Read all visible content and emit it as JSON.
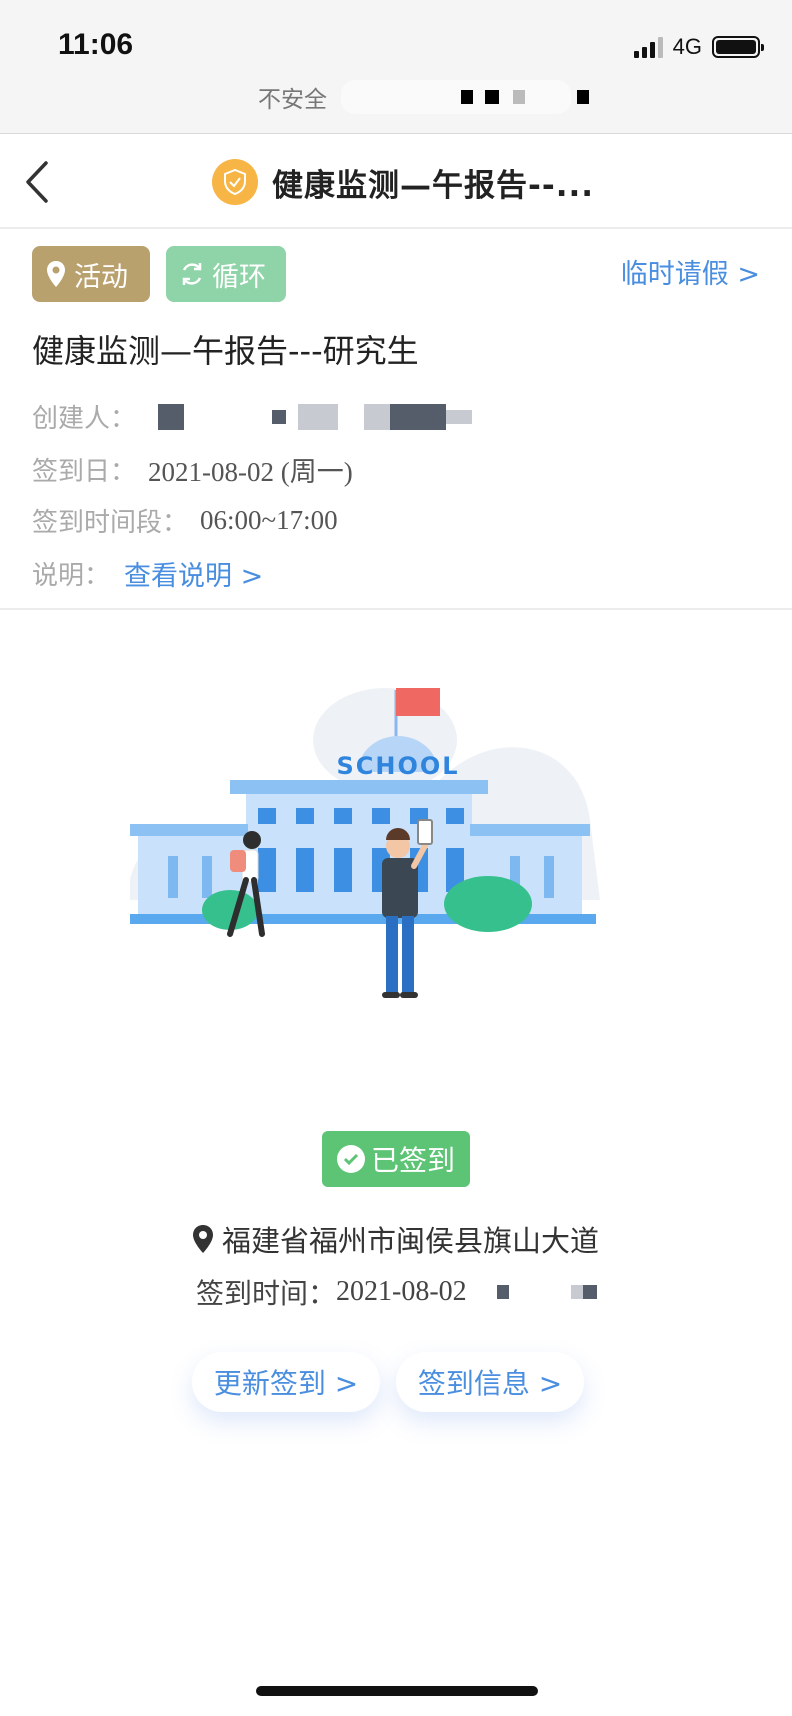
{
  "status_bar": {
    "time": "11:06",
    "network": "4G"
  },
  "url_bar": {
    "security_label": "不安全"
  },
  "nav": {
    "title": "健康监测—午报告--..."
  },
  "tags": {
    "activity": "活动",
    "loop": "循环"
  },
  "leave_link": "临时请假 >",
  "task": {
    "title": "健康监测—午报告---研究生",
    "creator_label": "创建人：",
    "date_label": "签到日：",
    "date_value": "2021-08-02 (周一)",
    "period_label": "签到时间段：",
    "period_value": "06:00~17:00",
    "desc_label": "说明：",
    "desc_link": "查看说明 >"
  },
  "illustration": {
    "building_text": "SCHOOL"
  },
  "checkin": {
    "badge": "已签到",
    "location": "福建省福州市闽侯县旗山大道",
    "time_label": "签到时间：",
    "time_value": "2021-08-02"
  },
  "actions": {
    "update": "更新签到 >",
    "info": "签到信息 >"
  },
  "colors": {
    "accent_blue": "#4a8ee0",
    "activity_tag": "#b9a16e",
    "loop_tag": "#8fd3a8",
    "signed_green": "#5cc474",
    "shield_orange": "#f6b544"
  }
}
